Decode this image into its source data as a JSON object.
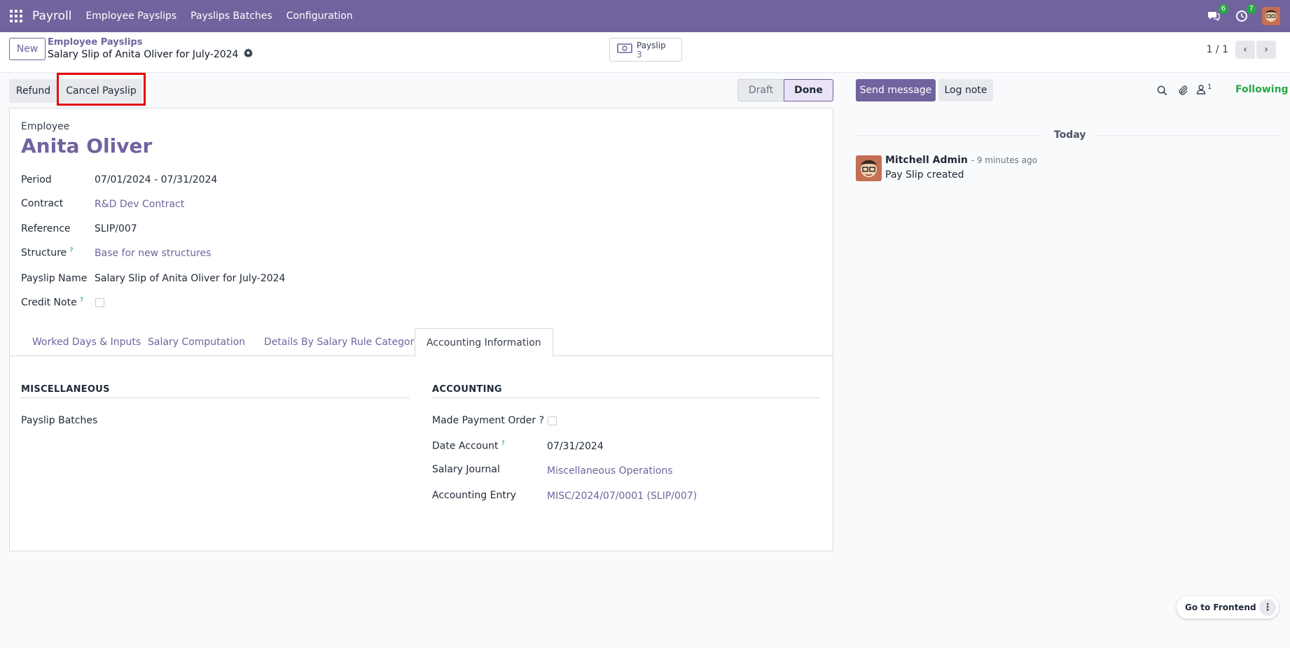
{
  "topbar": {
    "app_name": "Payroll",
    "menu": [
      "Employee Payslips",
      "Payslips Batches",
      "Configuration"
    ],
    "messages_badge": "6",
    "activities_badge": "7"
  },
  "control": {
    "new_label": "New",
    "breadcrumb_parent": "Employee Payslips",
    "breadcrumb_current": "Salary Slip of Anita Oliver for July-2024",
    "smart_button": {
      "label": "Payslip",
      "count": "3"
    },
    "pager_value": "1 / 1"
  },
  "actions": {
    "refund_label": "Refund",
    "cancel_label": "Cancel Payslip"
  },
  "status": {
    "steps": [
      "Draft",
      "Done"
    ],
    "current": "Done"
  },
  "form": {
    "employee_label": "Employee",
    "employee_name": "Anita Oliver",
    "fields": [
      {
        "label": "Period",
        "value": "07/01/2024 - 07/31/2024"
      },
      {
        "label": "Contract",
        "value": "R&D Dev Contract"
      },
      {
        "label": "Reference",
        "value": "SLIP/007"
      },
      {
        "label": "Structure",
        "value": "Base for new structures"
      },
      {
        "label": "Payslip Name",
        "value": "Salary Slip of Anita Oliver for July-2024"
      },
      {
        "label": "Credit Note",
        "value": ""
      }
    ],
    "help_mark": "?",
    "tabs": [
      "Worked Days & Inputs",
      "Salary Computation",
      "Details By Salary Rule Category",
      "Accounting Information"
    ],
    "active_tab": "Accounting Information",
    "misc": {
      "title": "MISCELLANEOUS",
      "payslip_batches_label": "Payslip Batches"
    },
    "accounting": {
      "title": "ACCOUNTING",
      "made_payment_label": "Made Payment Order ?",
      "date_account_label": "Date Account",
      "date_account_value": "07/31/2024",
      "salary_journal_label": "Salary Journal",
      "salary_journal_value": "Miscellaneous Operations",
      "accounting_entry_label": "Accounting Entry",
      "accounting_entry_value": "MISC/2024/07/0001 (SLIP/007)"
    }
  },
  "chatter": {
    "send_label": "Send message",
    "log_label": "Log note",
    "followers_count": "1",
    "following_label": "Following",
    "date_separator": "Today",
    "message": {
      "author": "Mitchell Admin",
      "time": "- 9 minutes ago",
      "body": "Pay Slip created"
    }
  },
  "frontend": {
    "label": "Go to Frontend",
    "more": "⋮"
  },
  "colors": {
    "brand": "#71639e",
    "highlight": "#e3070a",
    "following": "#28a745"
  }
}
